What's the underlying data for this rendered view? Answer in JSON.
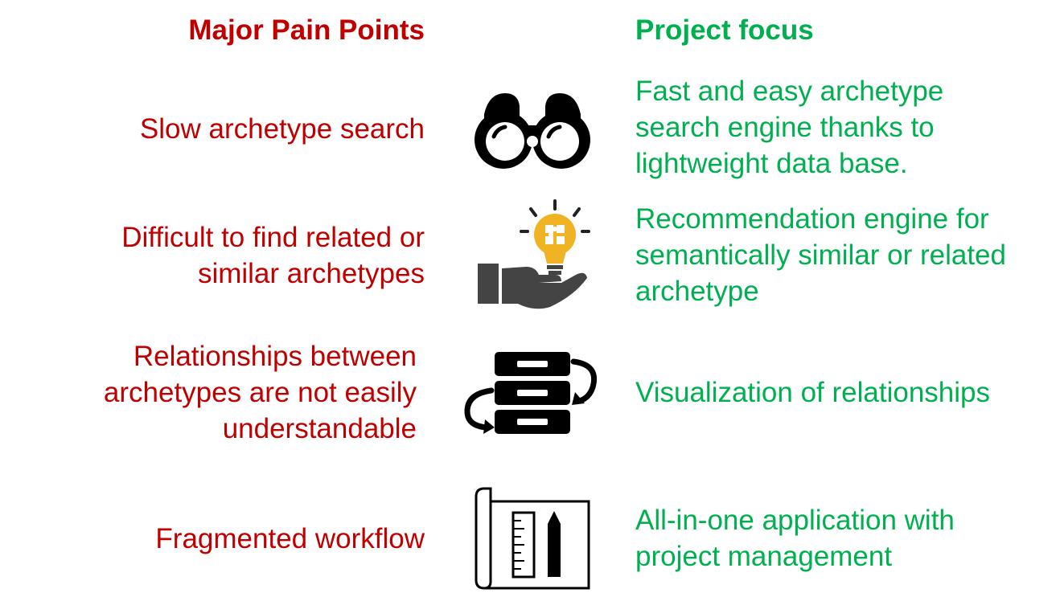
{
  "headers": {
    "pain": "Major Pain Points",
    "focus": "Project focus"
  },
  "colors": {
    "pain": "#c00000",
    "focus": "#00b050",
    "icon": "#000000",
    "bulb": "#f0b323"
  },
  "rows": [
    {
      "pain": "Slow archetype search",
      "icon": "binoculars-icon",
      "focus": "Fast and easy archetype\nsearch engine thanks to\nlightweight data base."
    },
    {
      "pain": "Difficult to find related or\nsimilar archetypes",
      "icon": "lightbulb-puzzle-hand-icon",
      "focus": "Recommendation engine for\nsemantically similar or related\narchetype"
    },
    {
      "pain": "Relationships between\narchetypes are not easily\nunderstandable",
      "icon": "server-sync-icon",
      "focus": "Visualization of relationships"
    },
    {
      "pain": "Fragmented workflow",
      "icon": "blueprint-icon",
      "focus": "All-in-one application with\nproject management"
    }
  ]
}
